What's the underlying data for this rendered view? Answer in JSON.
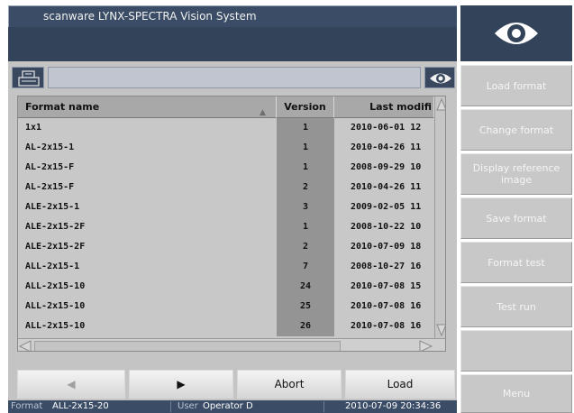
{
  "window": {
    "title": "scanware LYNX-SPECTRA Vision System"
  },
  "table": {
    "headers": {
      "format": "Format name",
      "version": "Version",
      "modified": "Last modifi"
    },
    "rows": [
      {
        "format": "1x1",
        "version": "1",
        "modified": "2010-06-01 12"
      },
      {
        "format": "AL-2x15-1",
        "version": "1",
        "modified": "2010-04-26 11"
      },
      {
        "format": "AL-2x15-F",
        "version": "1",
        "modified": "2008-09-29 10"
      },
      {
        "format": "AL-2x15-F",
        "version": "2",
        "modified": "2010-04-26 11"
      },
      {
        "format": "ALE-2x15-1",
        "version": "3",
        "modified": "2009-02-05 11"
      },
      {
        "format": "ALE-2x15-2F",
        "version": "1",
        "modified": "2008-10-22 10"
      },
      {
        "format": "ALE-2x15-2F",
        "version": "2",
        "modified": "2010-07-09 18"
      },
      {
        "format": "ALL-2x15-1",
        "version": "7",
        "modified": "2008-10-27 16"
      },
      {
        "format": "ALL-2x15-10",
        "version": "24",
        "modified": "2010-07-08 15"
      },
      {
        "format": "ALL-2x15-10",
        "version": "25",
        "modified": "2010-07-08 16"
      },
      {
        "format": "ALL-2x15-10",
        "version": "26",
        "modified": "2010-07-08 16"
      }
    ]
  },
  "nav": {
    "abort_label": "Abort",
    "load_label": "Load"
  },
  "status_bar": {
    "format_label": "Format",
    "format_value": "ALL-2x15-20",
    "user_label": "User",
    "user_value": "Operator D",
    "datetime": "2010-07-09 20:34:36"
  },
  "side_menu": {
    "load_format": "Load format",
    "change_format": "Change format",
    "display_reference": "Display reference image",
    "save_format": "Save format",
    "format_test": "Format test",
    "test_run": "Test run",
    "menu": "Menu"
  },
  "colors": {
    "title_bg": "#3b4d66",
    "panel_bg": "#c4c4c4",
    "version_col": "#949494",
    "button_text_disabled": "#f5f5f5"
  }
}
